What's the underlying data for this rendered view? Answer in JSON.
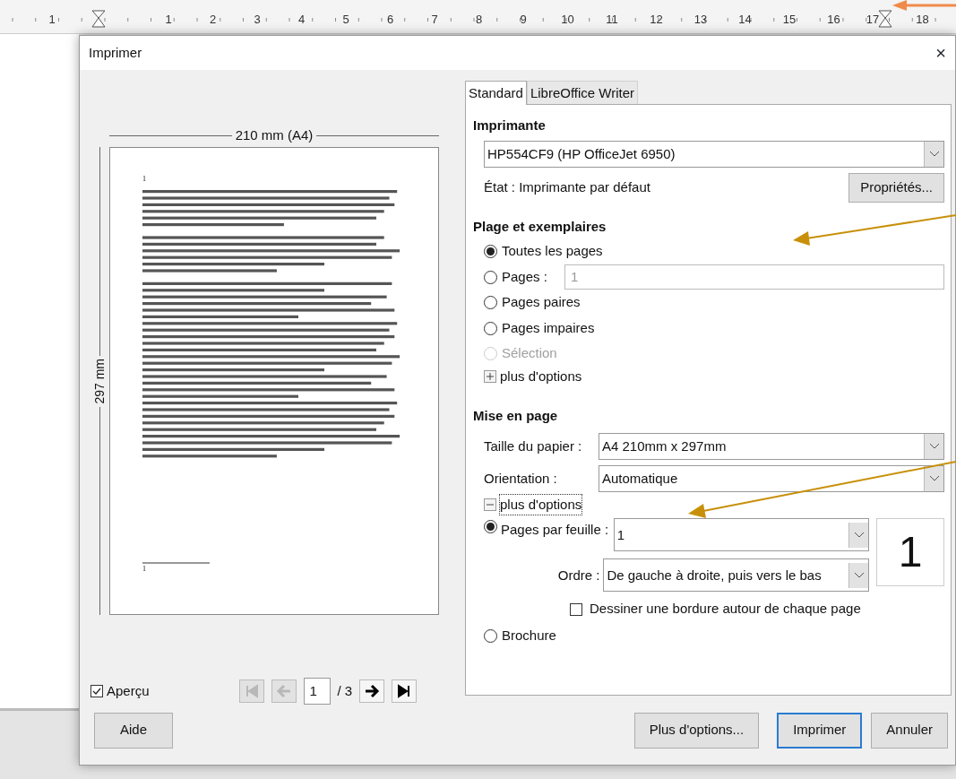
{
  "ruler": {
    "labels": [
      "1",
      "1",
      "2",
      "3",
      "4",
      "5",
      "6",
      "7",
      "8",
      "9",
      "10",
      "11",
      "12",
      "13",
      "14",
      "15",
      "16",
      "17",
      "18"
    ]
  },
  "dialog": {
    "title": "Imprimer",
    "close": "×"
  },
  "preview": {
    "width_label": "210 mm (A4)",
    "height_label": "297 mm",
    "header_mark": "1",
    "footnote_mark": "1"
  },
  "preview_toggle": {
    "label": "Aperçu",
    "checked": true
  },
  "pager": {
    "page": "1",
    "total": "/ 3",
    "buttons": [
      {
        "kind": "first",
        "disabled": true
      },
      {
        "kind": "prev",
        "disabled": true
      },
      {
        "kind": "next",
        "disabled": false
      },
      {
        "kind": "last",
        "disabled": false
      }
    ]
  },
  "tabs": [
    {
      "label": "Standard",
      "selected": true
    },
    {
      "label": "LibreOffice Writer",
      "selected": false
    }
  ],
  "printer": {
    "heading": "Imprimante",
    "value": "HP554CF9 (HP OfficeJet 6950)",
    "status_label": "État :",
    "status": "Imprimante par défaut",
    "properties_button": "Propriétés..."
  },
  "range": {
    "heading": "Plage et exemplaires",
    "options": [
      {
        "label": "Toutes les pages",
        "selected": true,
        "disabled": false
      },
      {
        "label": "Pages :",
        "selected": false,
        "disabled": false,
        "field": "1"
      },
      {
        "label": "Pages paires",
        "selected": false,
        "disabled": false
      },
      {
        "label": "Pages impaires",
        "selected": false,
        "disabled": false
      },
      {
        "label": "Sélection",
        "selected": false,
        "disabled": true
      }
    ],
    "more": {
      "label": "plus d'options",
      "expanded": false
    }
  },
  "layout": {
    "heading": "Mise en page",
    "paper_label": "Taille du papier :",
    "paper": "A4 210mm x 297mm",
    "orientation_label": "Orientation :",
    "orientation": "Automatique",
    "more": {
      "label": "plus d'options",
      "expanded": true
    },
    "pages_per_sheet": {
      "label": "Pages par feuille :",
      "selected": true,
      "value": "1",
      "preview": "1"
    },
    "order_label": "Ordre :",
    "order": "De gauche à droite, puis vers le bas",
    "border": {
      "label": "Dessiner une bordure autour de chaque page",
      "checked": false
    },
    "brochure": {
      "label": "Brochure",
      "selected": false
    }
  },
  "buttons": [
    {
      "label": "Aide",
      "kind": "help"
    },
    {
      "label": "Plus d'options...",
      "kind": "more"
    },
    {
      "label": "Imprimer",
      "kind": "default"
    },
    {
      "label": "Annuler",
      "kind": "cancel"
    }
  ]
}
